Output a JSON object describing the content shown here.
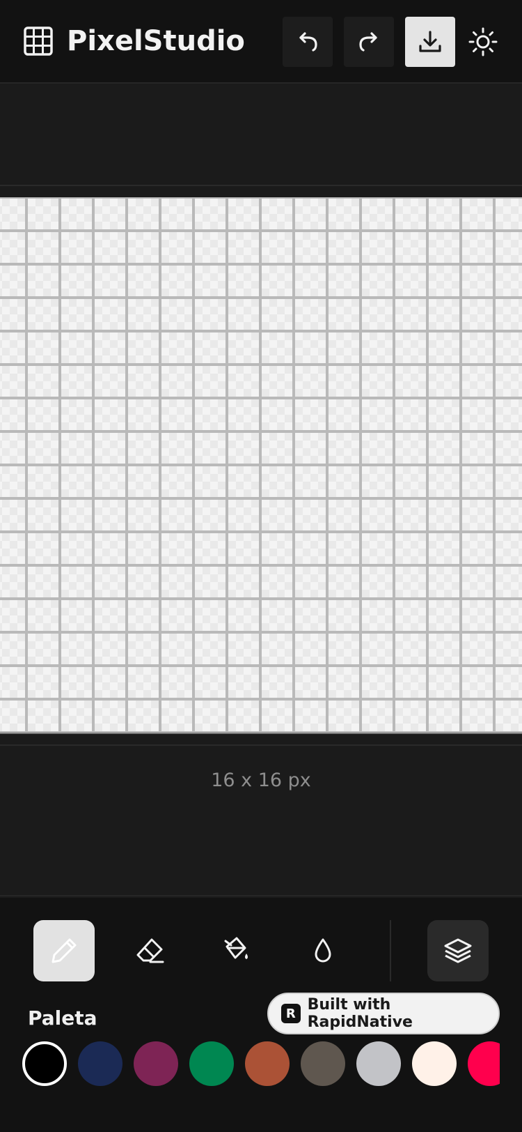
{
  "app": {
    "title": "PixelStudio"
  },
  "header": {
    "icons": {
      "logo": "grid-icon",
      "undo": "undo-icon",
      "redo": "redo-icon",
      "export": "download-icon",
      "theme": "sun-icon"
    }
  },
  "canvas": {
    "size_label": "16 x 16 px"
  },
  "toolbar": {
    "tools": [
      {
        "name": "pencil",
        "icon": "pencil-icon",
        "active": true
      },
      {
        "name": "eraser",
        "icon": "eraser-icon",
        "active": false
      },
      {
        "name": "fill",
        "icon": "paint-bucket-icon",
        "active": false
      },
      {
        "name": "eyedropper",
        "icon": "droplet-icon",
        "active": false
      },
      {
        "name": "layers",
        "icon": "layers-icon",
        "active": false
      }
    ]
  },
  "palette": {
    "label": "Paleta",
    "colors": [
      "#000000",
      "#1b2a55",
      "#7e2455",
      "#008751",
      "#ab5236",
      "#5f574f",
      "#c2c3c7",
      "#fff1e8",
      "#ff004d"
    ],
    "selected_index": 0
  },
  "badge": {
    "text": "Built with RapidNative"
  }
}
